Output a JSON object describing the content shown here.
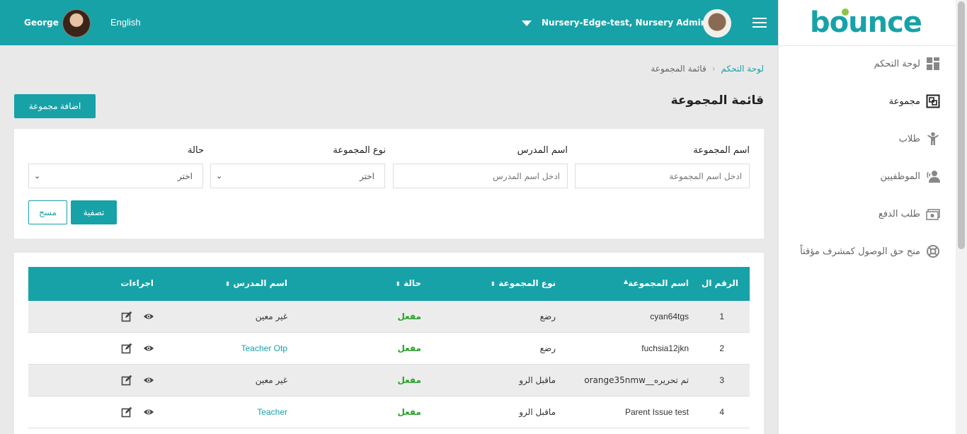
{
  "header": {
    "user_name": "George",
    "language": "English",
    "org_label": "Nursery-Edge-test, Nursery Admin"
  },
  "sidebar": {
    "logo": "bounce",
    "items": [
      {
        "label": "لوحة التحكم",
        "icon": "dashboard-icon"
      },
      {
        "label": "مجموعة",
        "icon": "group-icon",
        "active": true
      },
      {
        "label": "طلاب",
        "icon": "student-icon"
      },
      {
        "label": "الموظفيين",
        "icon": "staff-icon"
      },
      {
        "label": "طلب الدفع",
        "icon": "payment-icon"
      },
      {
        "label": "منح حق الوصول كمشرف مؤقتاً",
        "icon": "lifebuoy-icon"
      }
    ]
  },
  "breadcrumb": {
    "home": "لوحة التحكم",
    "current": "قائمة المجموعة"
  },
  "page": {
    "title": "قائمة المجموعة",
    "add_button": "اضافة مجموعة"
  },
  "filters": {
    "group_name_label": "اسم المجموعة",
    "group_name_placeholder": "ادخل اسم المجموعة",
    "teacher_name_label": "اسم المدرس",
    "teacher_name_placeholder": "ادخل اسم المدرس",
    "group_type_label": "نوع المجموعة",
    "group_type_value": "اختر",
    "status_label": "حالة",
    "status_value": "اختر",
    "filter_button": "تصفية",
    "clear_button": "مسح"
  },
  "table": {
    "columns": {
      "number": "الرقم ال",
      "group_name": "اسم المجموعة",
      "group_type": "نوع المجموعة",
      "status": "حالة",
      "teacher": "اسم المدرس",
      "actions": "اجراءات"
    },
    "rows": [
      {
        "number": "1",
        "group_name": "cyan64tgs",
        "group_type": "رضع",
        "status": "مفعل",
        "teacher": "غير معين",
        "teacher_is_link": false
      },
      {
        "number": "2",
        "group_name": "fuchsia12jkn",
        "group_type": "رضع",
        "status": "مفعل",
        "teacher": "Teacher Otp",
        "teacher_is_link": true
      },
      {
        "number": "3",
        "group_name": "orange35nmw__تم تحريره",
        "group_type": "ماقبل الرو",
        "status": "مفعل",
        "teacher": "غير معين",
        "teacher_is_link": false
      },
      {
        "number": "4",
        "group_name": "Parent Issue test",
        "group_type": "ماقبل الرو",
        "status": "مفعل",
        "teacher": "Teacher",
        "teacher_is_link": true
      }
    ]
  },
  "colors": {
    "primary": "#17a2a8",
    "status_active": "#2aa02a",
    "logo_dot": "#8cc63f"
  }
}
